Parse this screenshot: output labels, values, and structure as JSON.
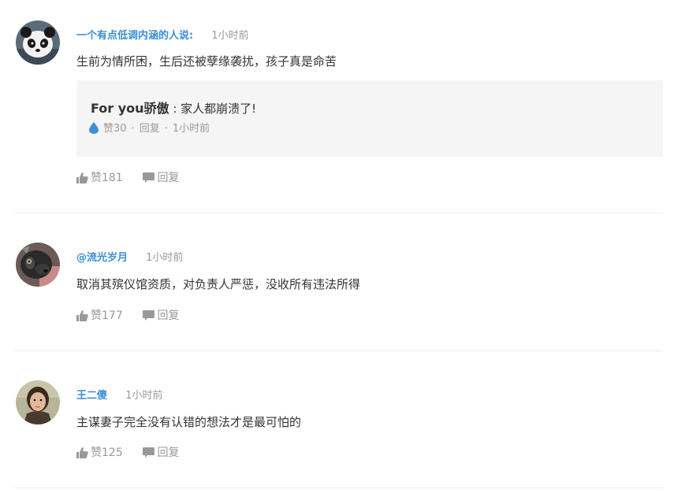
{
  "comments": [
    {
      "username": "一个有点低调内涵的人说:",
      "time": "1小时前",
      "text": "生前为情所困，生后还被孽缘袭扰，孩子真是命苦",
      "avatar_icon": "panda-avatar",
      "reply": {
        "author": "For you骄傲",
        "separator": " : ",
        "content": "家人都崩溃了!",
        "likes": "赞30",
        "reply_label": "回复",
        "time": "1小时前"
      },
      "likes": "赞181",
      "reply_label": "回复"
    },
    {
      "username": "@流光岁月",
      "time": "1小时前",
      "text": "取消其殡仪馆资质，对负责人严惩，没收所有违法所得",
      "avatar_icon": "dog-avatar",
      "likes": "赞177",
      "reply_label": "回复"
    },
    {
      "username": "王二傻",
      "time": "1小时前",
      "text": "主谋妻子完全没有认错的想法才是最可怕的",
      "avatar_icon": "portrait-avatar",
      "likes": "赞125",
      "reply_label": "回复"
    }
  ],
  "colors": {
    "username": "#3c8ed8",
    "muted": "#999999",
    "text": "#333333",
    "reply_bg": "#f5f5f5",
    "divider": "#eeeeee",
    "drop_icon": "#3c8ed8"
  }
}
